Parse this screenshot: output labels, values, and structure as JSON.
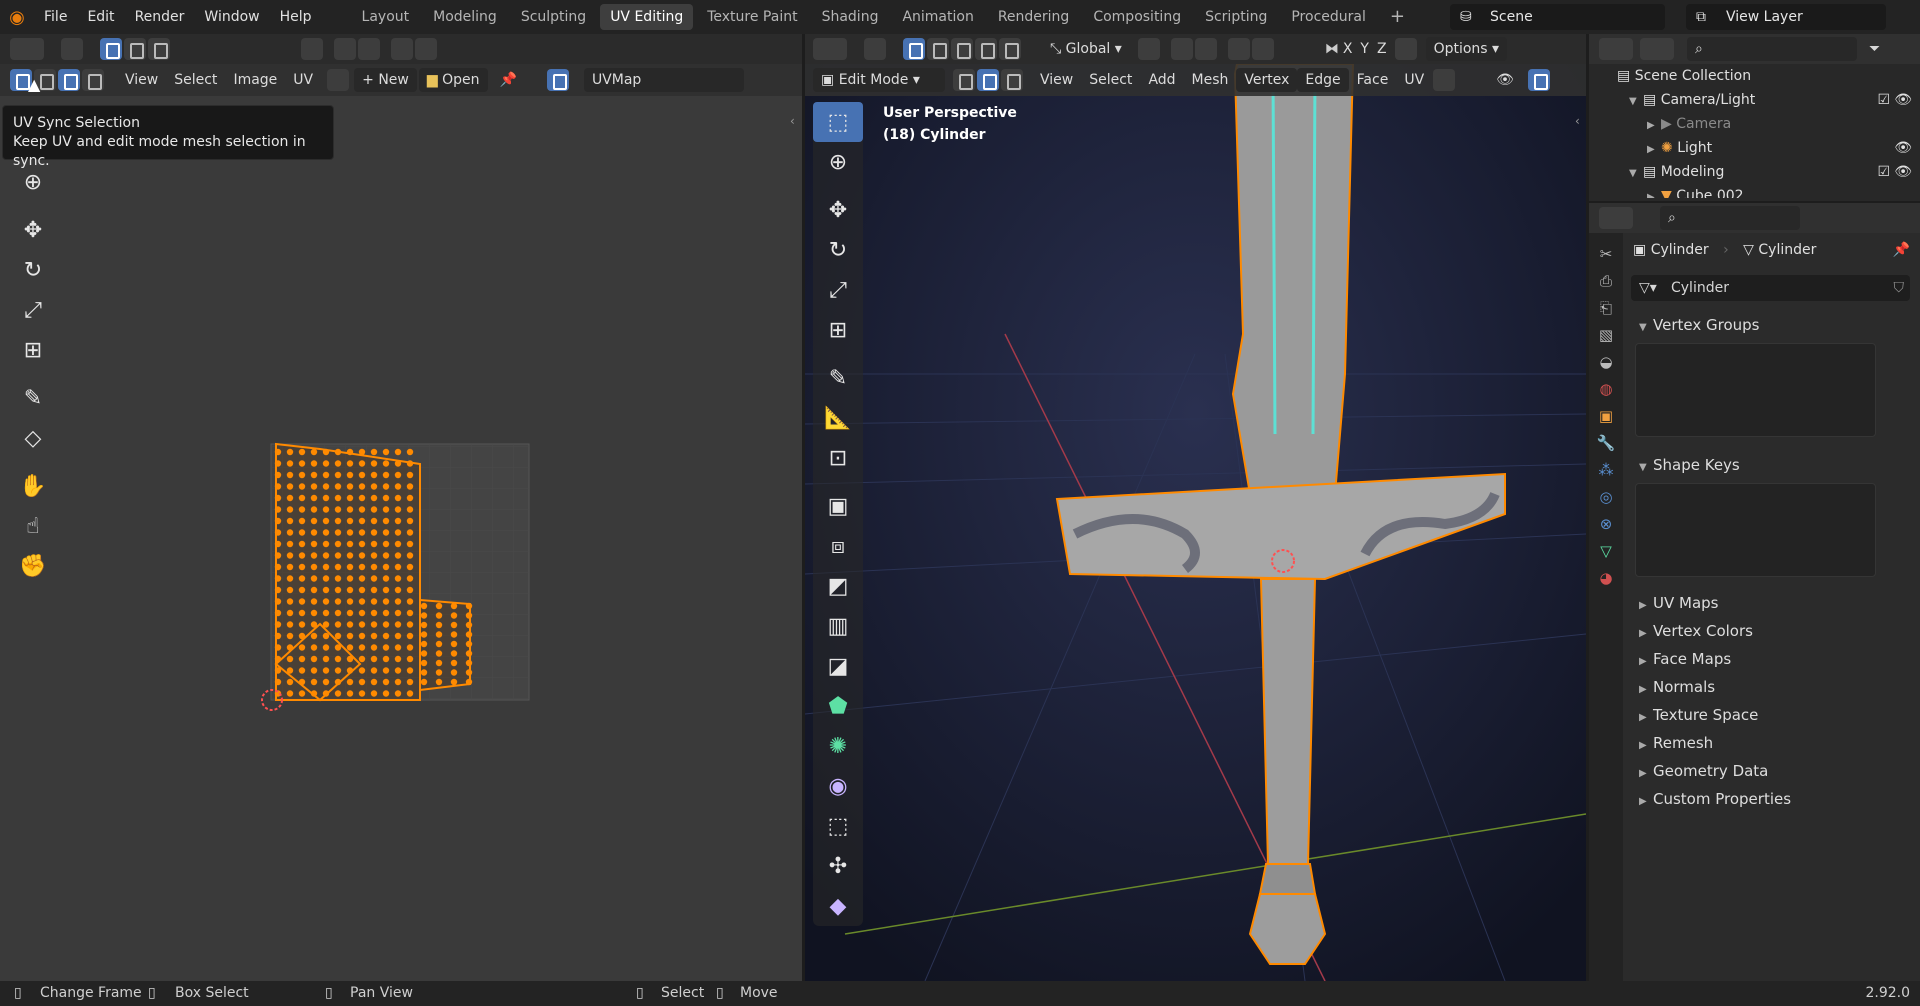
{
  "app": {
    "menus": [
      "File",
      "Edit",
      "Render",
      "Window",
      "Help"
    ],
    "workspaces": [
      {
        "label": "Layout",
        "active": false
      },
      {
        "label": "Modeling",
        "active": false
      },
      {
        "label": "Sculpting",
        "active": false
      },
      {
        "label": "UV Editing",
        "active": true
      },
      {
        "label": "Texture Paint",
        "active": false
      },
      {
        "label": "Shading",
        "active": false
      },
      {
        "label": "Animation",
        "active": false
      },
      {
        "label": "Rendering",
        "active": false
      },
      {
        "label": "Compositing",
        "active": false
      },
      {
        "label": "Scripting",
        "active": false
      },
      {
        "label": "Procedural",
        "active": false
      }
    ],
    "add_workspace": "+",
    "scene": "Scene",
    "view_layer": "View Layer",
    "version": "2.92.0"
  },
  "uv_editor": {
    "menus": [
      "View",
      "Select",
      "Image",
      "UV"
    ],
    "new_label": "New",
    "open_label": "Open",
    "uvmap": "UVMap",
    "tooltip": {
      "title": "UV Sync Selection",
      "description": "Keep UV and edit mode mesh selection in sync."
    }
  },
  "viewport": {
    "mode": "Edit Mode",
    "menus": [
      "View",
      "Select",
      "Add",
      "Mesh",
      "Vertex",
      "Edge",
      "Face",
      "UV"
    ],
    "orientation": "Global",
    "options_label": "Options",
    "axes": [
      "X",
      "Y",
      "Z"
    ],
    "overlay_title": "User Perspective",
    "overlay_subtitle": "(18) Cylinder"
  },
  "outliner": {
    "rows": [
      {
        "label": "Scene Collection",
        "level": 0
      },
      {
        "label": "Camera/Light",
        "level": 1
      },
      {
        "label": "Camera",
        "level": 2,
        "dim": true
      },
      {
        "label": "Light",
        "level": 2
      },
      {
        "label": "Modeling",
        "level": 1
      },
      {
        "label": "Cube.002",
        "level": 2
      }
    ]
  },
  "properties": {
    "breadcrumb_object": "Cylinder",
    "breadcrumb_data": "Cylinder",
    "mesh_name": "Cylinder",
    "panels_open": [
      "Vertex Groups",
      "Shape Keys"
    ],
    "panels_closed": [
      "UV Maps",
      "Vertex Colors",
      "Face Maps",
      "Normals",
      "Texture Space",
      "Remesh",
      "Geometry Data",
      "Custom Properties"
    ]
  },
  "status": {
    "items": [
      "Change Frame",
      "Box Select",
      "Pan View",
      "Select",
      "Move"
    ]
  },
  "colors": {
    "selection": "#ff8a00",
    "accent": "#4772b3",
    "edge_seam": "#5de0d4"
  }
}
